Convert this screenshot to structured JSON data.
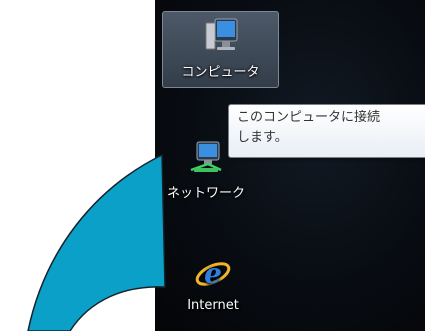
{
  "desktop": {
    "icons": [
      {
        "label": "コンピュータ",
        "icon": "computer-icon",
        "selected": true
      },
      {
        "label": "ネットワーク",
        "icon": "network-icon",
        "selected": false
      },
      {
        "label": "Internet",
        "icon": "internet-explorer-icon",
        "selected": false
      }
    ],
    "tooltip": {
      "line1": "このコンピュータに接続",
      "line2": "します。"
    }
  },
  "colors": {
    "arc_fill": "#0aa0c8",
    "arc_stroke": "#1a2430",
    "desktop_bg": "#0b0f16",
    "selection": "#5a6a7e"
  }
}
